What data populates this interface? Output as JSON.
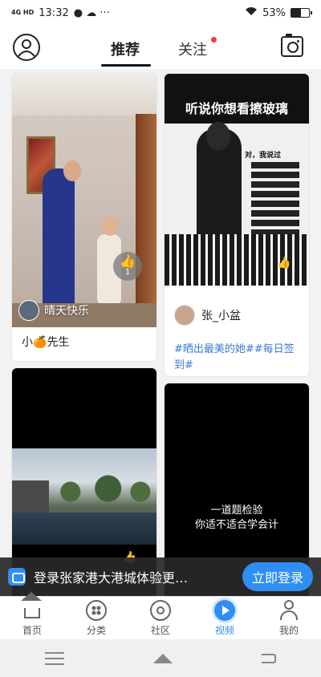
{
  "status_bar": {
    "network": "4G HD",
    "time": "13:32",
    "battery": "53%",
    "battery_level": 0.53
  },
  "header": {
    "tabs": [
      {
        "label": "推荐",
        "active": true
      },
      {
        "label": "关注",
        "active": false,
        "has_dot": true
      }
    ]
  },
  "feed": {
    "cards": [
      {
        "author": "晴天快乐",
        "like_count": "1",
        "caption_prefix": "小",
        "caption_emoji": "🍊",
        "caption_suffix": "先生"
      },
      {
        "image_title": "听说你想看擦玻璃",
        "image_speech": "对，我说过",
        "author": "张_小盆",
        "topic": "#晒出最美的她##每日签到#"
      },
      {},
      {
        "quiz_line1": "一道题检验",
        "quiz_line2": "你适不适合学会计"
      }
    ]
  },
  "login_banner": {
    "text": "登录张家港大港城体验更…",
    "button": "立即登录"
  },
  "bottom_nav": {
    "items": [
      {
        "label": "首页",
        "icon": "home-icon"
      },
      {
        "label": "分类",
        "icon": "category-icon"
      },
      {
        "label": "社区",
        "icon": "community-icon"
      },
      {
        "label": "视频",
        "icon": "video-icon",
        "active": true
      },
      {
        "label": "我的",
        "icon": "profile-icon"
      }
    ]
  },
  "colors": {
    "accent": "#2f8ef4",
    "notification_dot": "#f23c3c",
    "link": "#3a7bd5"
  }
}
